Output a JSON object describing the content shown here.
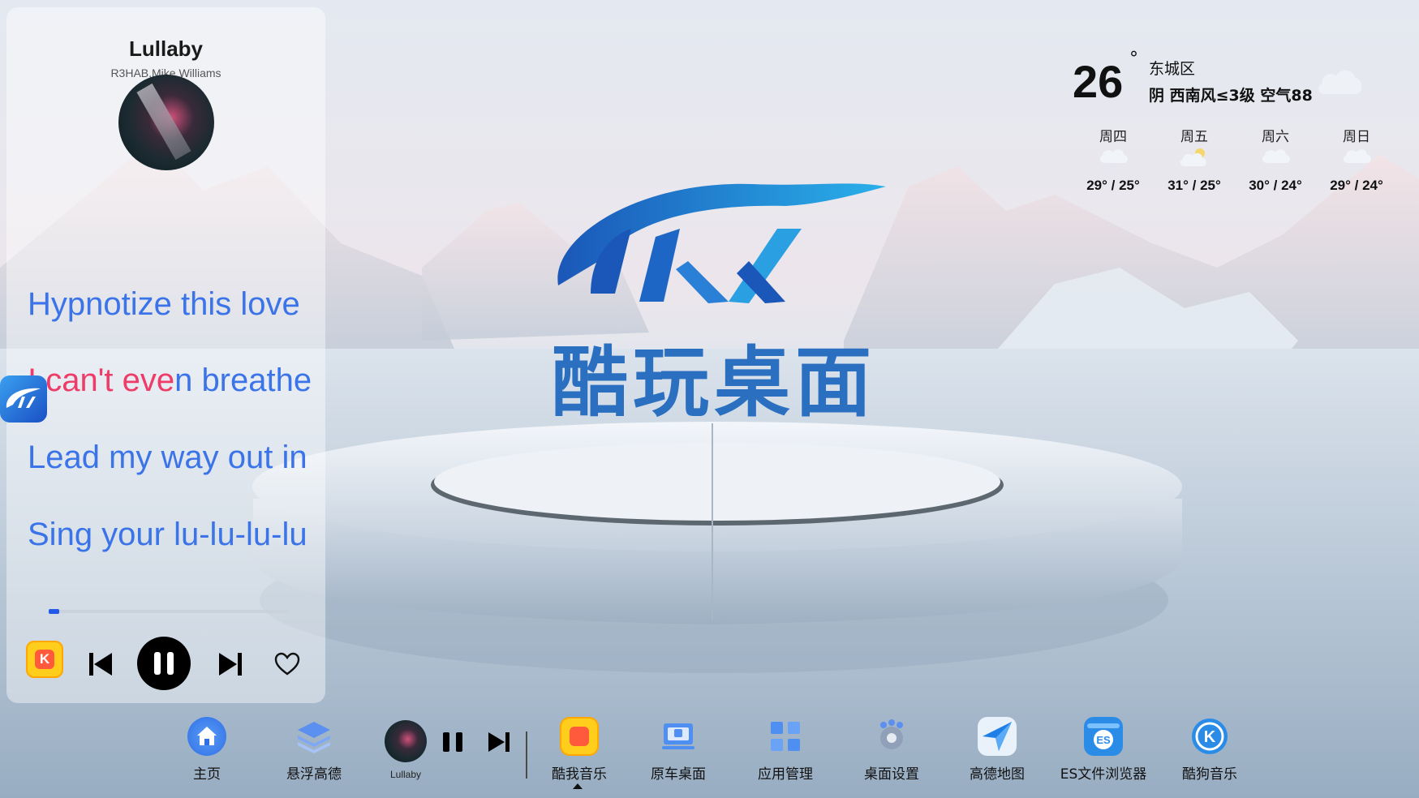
{
  "music": {
    "title": "Lullaby",
    "artist": "R3HAB,Mike Williams",
    "lyrics": [
      {
        "text": "Hypnotize this love"
      },
      {
        "sung": "I can't eve",
        "unsung": "n breathe"
      },
      {
        "text": "Lead my way out in"
      },
      {
        "text": "Sing your lu-lu-lu-lu"
      }
    ],
    "progress": 0.045,
    "app_icon_letter": "K"
  },
  "center_logo": {
    "text": "酷玩桌面"
  },
  "weather": {
    "temperature": "26",
    "degree": "°",
    "district": "东城区",
    "condition": "阴  西南风≤3级  空气88",
    "forecast": [
      {
        "day": "周四",
        "icon": "cloud-rain-icon",
        "range": "29° / 25°"
      },
      {
        "day": "周五",
        "icon": "sun-cloud-icon",
        "range": "31° / 25°"
      },
      {
        "day": "周六",
        "icon": "cloud-drizzle-icon",
        "range": "30° / 24°"
      },
      {
        "day": "周日",
        "icon": "cloud-rain-icon",
        "range": "29° / 24°"
      }
    ]
  },
  "dock": {
    "home": "主页",
    "float_amap": "悬浮高德",
    "mini_track": "Lullaby",
    "kuwo": "酷我音乐",
    "oem_desktop": "原车桌面",
    "app_manager": "应用管理",
    "desktop_settings": "桌面设置",
    "amap": "高德地图",
    "es_file": "ES文件浏览器",
    "kugou": "酷狗音乐"
  },
  "colors": {
    "lyric_blue": "#3b73e8",
    "lyric_sung": "#ee3b68",
    "logo_blue": "#2b6fc0",
    "progress": "#2259e8"
  }
}
